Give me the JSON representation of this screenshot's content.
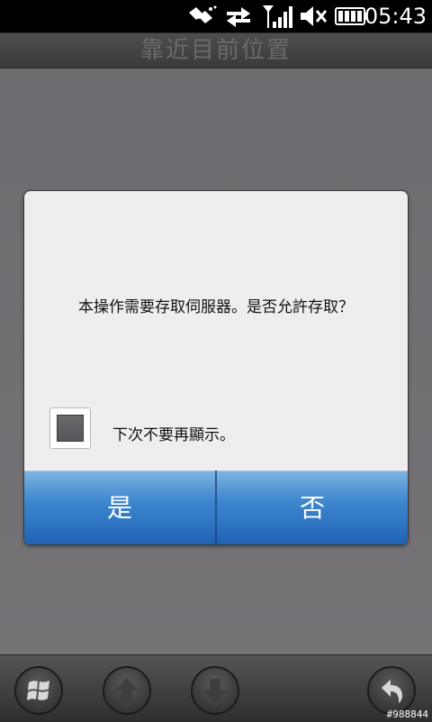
{
  "status_bar": {
    "time": "05:43",
    "icons": [
      "satellite-icon",
      "data-transfer-icon",
      "signal-icon",
      "volume-muted-icon",
      "battery-icon"
    ]
  },
  "title_bar": {
    "title": "靠近目前位置"
  },
  "dialog": {
    "message": "本操作需要存取伺服器。是否允許存取？",
    "checkbox_label": "下次不要再顯示。",
    "checkbox_checked": false,
    "yes_label": "是",
    "no_label": "否"
  },
  "bottom_bar": {
    "buttons": [
      "windows-start-icon",
      "arrow-up-icon",
      "arrow-down-icon",
      "back-icon"
    ]
  },
  "watermark": "#988844",
  "colors": {
    "button_blue": "#1f63b4",
    "dialog_bg": "#efedf0",
    "background": "#6f6d70"
  }
}
